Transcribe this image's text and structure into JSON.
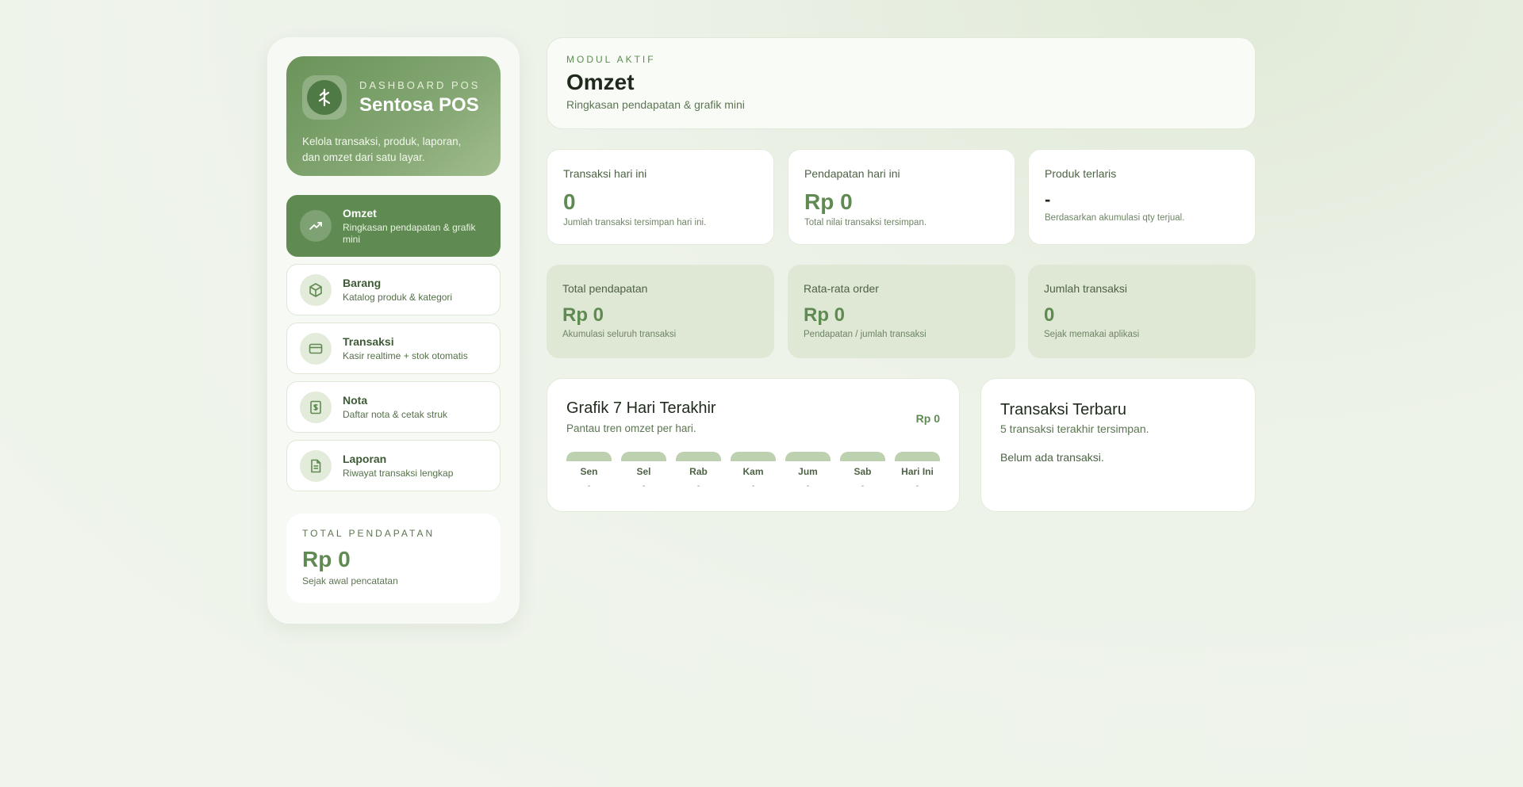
{
  "brand": {
    "kicker": "DASHBOARD POS",
    "name": "Sentosa POS",
    "description": "Kelola transaksi, produk, laporan, dan omzet dari satu layar.",
    "logo_icon": "tree-icon"
  },
  "nav": [
    {
      "title": "Omzet",
      "sub": "Ringkasan pendapatan & grafik mini",
      "icon": "trend-up-icon",
      "active": true
    },
    {
      "title": "Barang",
      "sub": "Katalog produk & kategori",
      "icon": "box-icon",
      "active": false
    },
    {
      "title": "Transaksi",
      "sub": "Kasir realtime + stok otomatis",
      "icon": "card-icon",
      "active": false
    },
    {
      "title": "Nota",
      "sub": "Daftar nota & cetak struk",
      "icon": "receipt-icon",
      "active": false
    },
    {
      "title": "Laporan",
      "sub": "Riwayat transaksi lengkap",
      "icon": "document-icon",
      "active": false
    }
  ],
  "sidebar_total": {
    "label": "TOTAL PENDAPATAN",
    "value": "Rp 0",
    "sub": "Sejak awal pencatatan"
  },
  "module": {
    "kicker": "MODUL AKTIF",
    "title": "Omzet",
    "sub": "Ringkasan pendapatan & grafik mini"
  },
  "stats_today": [
    {
      "label": "Transaksi hari ini",
      "value": "0",
      "sub": "Jumlah transaksi tersimpan hari ini."
    },
    {
      "label": "Pendapatan hari ini",
      "value": "Rp 0",
      "sub": "Total nilai transaksi tersimpan."
    },
    {
      "label": "Produk terlaris",
      "value": "-",
      "sub": "Berdasarkan akumulasi qty terjual."
    }
  ],
  "stats_all": [
    {
      "label": "Total pendapatan",
      "value": "Rp 0",
      "sub": "Akumulasi seluruh transaksi"
    },
    {
      "label": "Rata-rata order",
      "value": "Rp 0",
      "sub": "Pendapatan / jumlah transaksi"
    },
    {
      "label": "Jumlah transaksi",
      "value": "0",
      "sub": "Sejak memakai aplikasi"
    }
  ],
  "chart": {
    "title": "Grafik 7 Hari Terakhir",
    "sub": "Pantau tren omzet per hari.",
    "total": "Rp 0"
  },
  "chart_data": {
    "type": "bar",
    "categories": [
      "Sen",
      "Sel",
      "Rab",
      "Kam",
      "Jum",
      "Sab",
      "Hari Ini"
    ],
    "values": [
      0,
      0,
      0,
      0,
      0,
      0,
      0
    ],
    "value_labels": [
      "-",
      "-",
      "-",
      "-",
      "-",
      "-",
      "-"
    ]
  },
  "recent": {
    "title": "Transaksi Terbaru",
    "sub": "5 transaksi terakhir tersimpan.",
    "empty": "Belum ada transaksi."
  },
  "colors": {
    "accent": "#5f8b52",
    "accent_light": "#dfe8d5",
    "bar": "#bdd0b0"
  }
}
